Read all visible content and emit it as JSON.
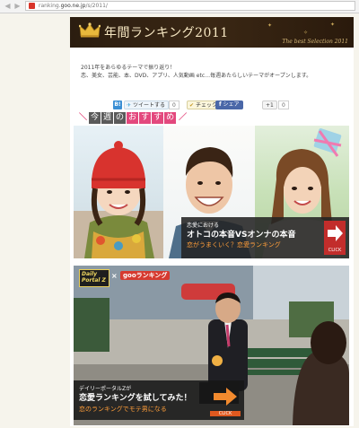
{
  "browser": {
    "back_icon": "back-arrow-icon",
    "forward_icon": "forward-arrow-icon",
    "favicon": "goo-favicon",
    "url_prefix": "ranking.",
    "url_domain": "goo.ne.jp",
    "url_path": "/s/2011/"
  },
  "banner": {
    "title": "年間ランキング2011",
    "subtitle": "The best Selection 2011",
    "icon": "crown-icon"
  },
  "intro": {
    "line1": "2011年をあらゆるテーマで振り返り！",
    "line2": "恋、美女、芸能、本、DVD、アプリ、人気動画 etc…毎週あたらしいテーマがオープンします。"
  },
  "social": {
    "hatena_label": "B!",
    "tweet_label": "ツイートする",
    "tweet_count": "0",
    "check_label": "チェック",
    "share_label": "シェア",
    "plusone_label": "+1",
    "plusone_count": "0"
  },
  "feature1": {
    "heading_parts": [
      "今",
      "週",
      "の",
      "お",
      "す",
      "す",
      "め"
    ],
    "caption_small": "恋愛における",
    "caption_main": "オトコの本音VSオンナの本音",
    "caption_sub": "恋がうまくいく？恋愛ランキング",
    "click_label": "CLICK"
  },
  "feature2": {
    "logo_line1": "Daily",
    "logo_line2": "Portal Z",
    "cross": "×",
    "goo_label": "gooランキング",
    "caption_small": "デイリーポータルZが",
    "caption_main": "恋愛ランキングを試してみた！",
    "caption_sub": "恋のランキングでモテ男になる",
    "click_label": "CLICK"
  },
  "colors": {
    "accent_pink": "#e3487d",
    "click_red": "#c22d2b",
    "caption_orange": "#ff9e3a",
    "banner_brown": "#2b1d10"
  }
}
